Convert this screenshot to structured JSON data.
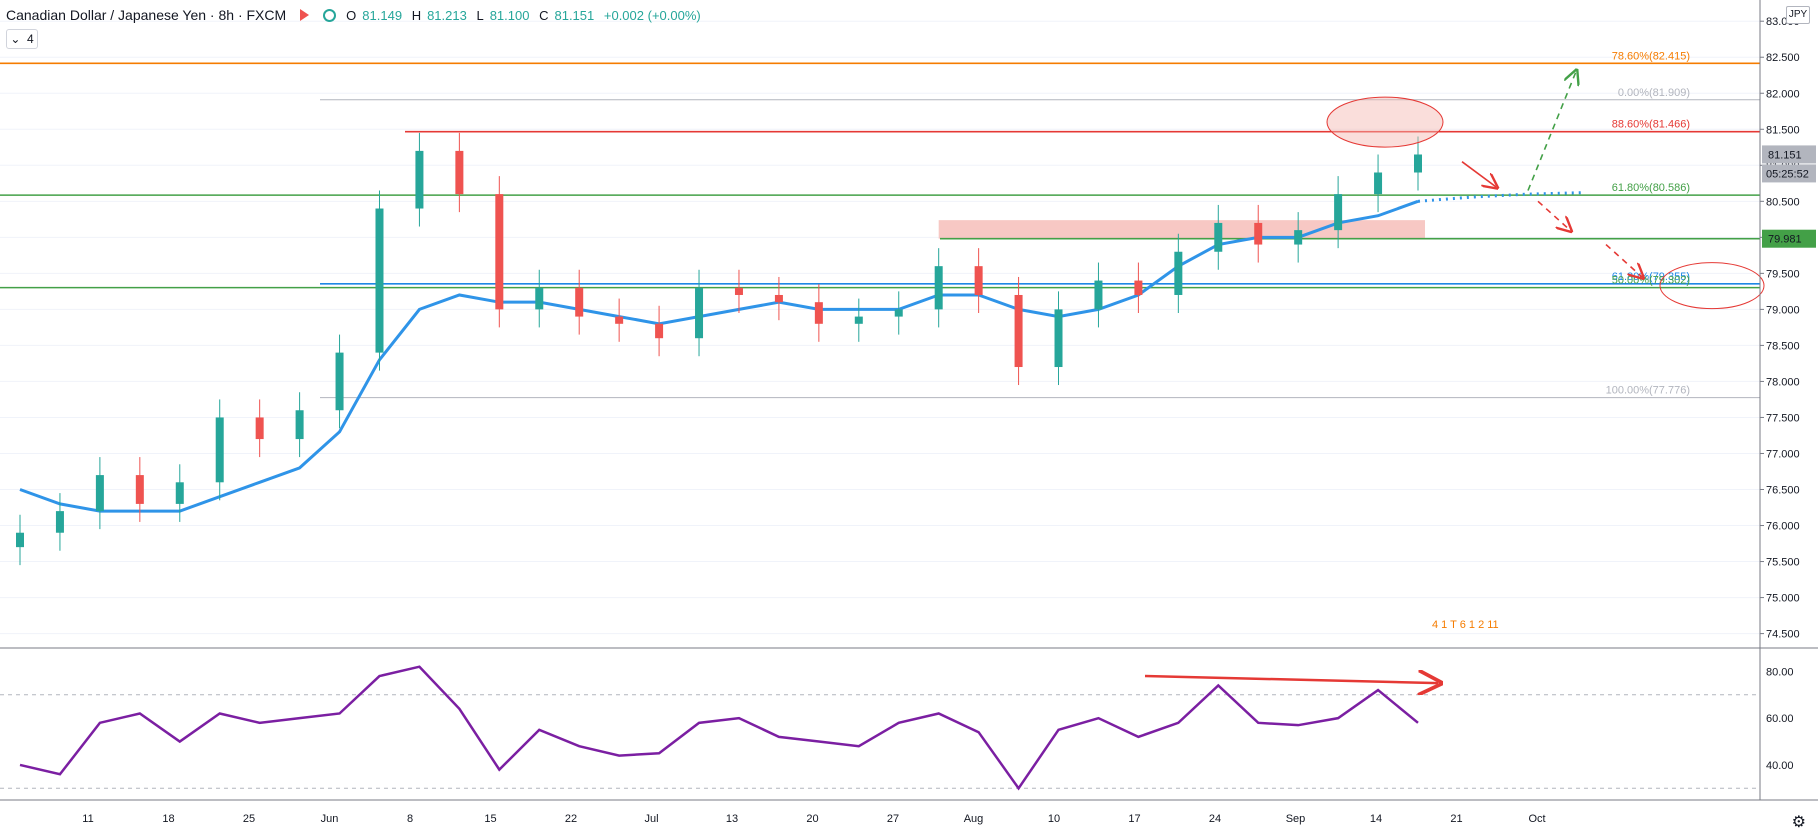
{
  "header": {
    "title": "Canadian Dollar / Japanese Yen · 8h · FXCM",
    "open_label": "O",
    "open": "81.149",
    "high_label": "H",
    "high": "81.213",
    "low_label": "L",
    "low": "81.100",
    "close_label": "C",
    "close": "81.151",
    "change": "+0.002 (+0.00%)",
    "interval_value": "4",
    "icons": [
      "flag-icon",
      "circle-indicator-icon",
      "chevron-down-icon"
    ]
  },
  "currency": "JPY",
  "colors": {
    "up": "#26a69a",
    "down": "#ef5350",
    "ema": "#2f94e8",
    "rsi": "#7b1fa2",
    "fib_orange": "#f57c00",
    "fib_red": "#e53935",
    "fib_green": "#43a047",
    "blue_level": "#1e88e5",
    "zone": "#f4b6b0",
    "arrow_red": "#e53935",
    "arrow_green": "#43a047"
  },
  "price_badges": {
    "last_price": "81.151",
    "countdown": "05:25:52",
    "level": "79.981"
  },
  "event_markers": "4 1 T 6 1 2 11",
  "chart_data": [
    {
      "type": "line",
      "title": "",
      "ylim": [
        74.3,
        83.1
      ],
      "yticks": [
        "83.000",
        "82.500",
        "82.000",
        "81.500",
        "81.000",
        "80.500",
        "80.000",
        "79.500",
        "79.000",
        "78.500",
        "78.000",
        "77.500",
        "77.000",
        "76.500",
        "76.000",
        "75.500",
        "75.000",
        "74.500"
      ],
      "xticks": [
        "11",
        "18",
        "25",
        "Jun",
        "8",
        "15",
        "22",
        "Jul",
        "13",
        "20",
        "27",
        "Aug",
        "10",
        "17",
        "24",
        "Sep",
        "14",
        "21",
        "Oct"
      ],
      "x": [
        "May 4",
        "May 7",
        "May 11",
        "May 14",
        "May 18",
        "May 21",
        "May 25",
        "May 28",
        "Jun 1",
        "Jun 4",
        "Jun 8",
        "Jun 11",
        "Jun 15",
        "Jun 18",
        "Jun 22",
        "Jun 25",
        "Jun 29",
        "Jul 2",
        "Jul 6",
        "Jul 9",
        "Jul 13",
        "Jul 16",
        "Jul 20",
        "Jul 23",
        "Jul 27",
        "Jul 30",
        "Aug 3",
        "Aug 6",
        "Aug 10",
        "Aug 13",
        "Aug 17",
        "Aug 20",
        "Aug 24",
        "Aug 27",
        "Aug 31",
        "Sep 2"
      ],
      "series": [
        {
          "name": "",
          "kind": "price",
          "values": [
            75.9,
            76.2,
            76.7,
            76.3,
            76.6,
            77.5,
            77.2,
            77.6,
            78.4,
            80.4,
            81.2,
            80.6,
            79.0,
            79.3,
            78.9,
            78.8,
            78.6,
            79.3,
            79.2,
            79.1,
            78.8,
            78.9,
            79.0,
            79.6,
            79.2,
            78.2,
            79.0,
            79.4,
            79.2,
            79.8,
            80.2,
            79.9,
            80.1,
            80.6,
            80.9,
            81.15
          ]
        },
        {
          "name": "",
          "kind": "ema",
          "values": [
            76.5,
            76.3,
            76.2,
            76.2,
            76.2,
            76.4,
            76.6,
            76.8,
            77.3,
            78.3,
            79.0,
            79.2,
            79.1,
            79.1,
            79.0,
            78.9,
            78.8,
            78.9,
            79.0,
            79.1,
            79.0,
            79.0,
            79.0,
            79.2,
            79.2,
            79.0,
            78.9,
            79.0,
            79.2,
            79.6,
            79.9,
            80.0,
            80.0,
            80.2,
            80.3,
            80.5
          ]
        }
      ],
      "projection": {
        "values": [
          80.5,
          80.56,
          80.6,
          80.62
        ]
      },
      "fib_levels": [
        {
          "label": "78.60%(82.415)",
          "value": 82.415,
          "color": "#f57c00"
        },
        {
          "label": "0.00%(81.909)",
          "value": 81.909,
          "color": "#b2b5be"
        },
        {
          "label": "88.60%(81.466)",
          "value": 81.466,
          "color": "#e53935"
        },
        {
          "label": "61.80%(80.586)",
          "value": 80.586,
          "color": "#43a047"
        },
        {
          "label": "61.80%(79.355)",
          "value": 79.355,
          "color": "#1e88e5"
        },
        {
          "label": "50.00%(79.302)",
          "value": 79.302,
          "color": "#43a047"
        },
        {
          "label": "100.00%(77.776)",
          "value": 77.776,
          "color": "#b2b5be"
        }
      ],
      "horizontal_level": {
        "value": 79.981
      },
      "zone": {
        "from": 79.981,
        "to": 80.1,
        "x_from": "Jul 23",
        "x_to": "Sep 4"
      },
      "annotations": [
        "resistance-ellipse",
        "support-ellipse",
        "bearish-arrows",
        "bullish-arrow"
      ]
    },
    {
      "type": "line",
      "title": "",
      "ylim": [
        25,
        90
      ],
      "yticks": [
        "80.00",
        "60.00",
        "40.00"
      ],
      "guides": [
        70,
        30
      ],
      "series": [
        {
          "name": "",
          "kind": "rsi",
          "values": [
            40,
            36,
            58,
            62,
            50,
            62,
            58,
            60,
            62,
            78,
            82,
            64,
            38,
            55,
            48,
            44,
            45,
            58,
            60,
            52,
            50,
            48,
            58,
            62,
            54,
            30,
            55,
            60,
            52,
            58,
            74,
            58,
            57,
            60,
            72,
            58
          ]
        }
      ],
      "divergence_arrow": {
        "from": 78,
        "to": 75
      }
    }
  ]
}
